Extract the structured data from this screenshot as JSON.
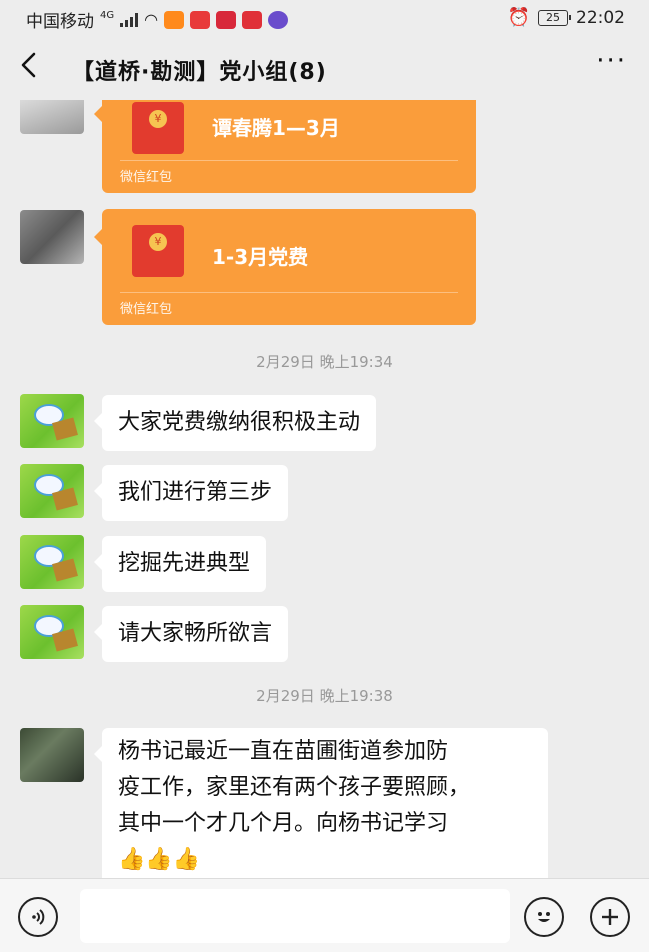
{
  "status_bar": {
    "carrier": "中国移动",
    "network": "4G",
    "battery": "25",
    "time": "22:02"
  },
  "header": {
    "title": "【道桥·勘测】党小组(8)",
    "back_icon": "back-arrow-icon",
    "more_label": "···"
  },
  "messages": {
    "red_packets": [
      {
        "title": "谭春腾1—3月",
        "footer": "微信红包"
      },
      {
        "title": "1-3月党费",
        "footer": "微信红包"
      }
    ],
    "time_1": "2月29日 晚上19:34",
    "texts": [
      "大家党费缴纳很积极主动",
      "我们进行第三步",
      "挖掘先进典型",
      "请大家畅所欲言"
    ],
    "time_2": "2月29日 晚上19:38",
    "long_message": {
      "lines": [
        "杨书记最近一直在苗圃街道参加防",
        "疫工作，家里还有两个孩子要照顾，",
        "其中一个才几个月。向杨书记学习"
      ],
      "emoji": "👍👍👍"
    }
  },
  "input_bar": {
    "voice_icon": "voice-icon",
    "emoji_icon": "emoji-icon",
    "plus_icon": "plus-icon",
    "placeholder": ""
  },
  "colors": {
    "background": "#ededed",
    "red_packet": "#fa9d3b",
    "bubble": "#ffffff"
  }
}
